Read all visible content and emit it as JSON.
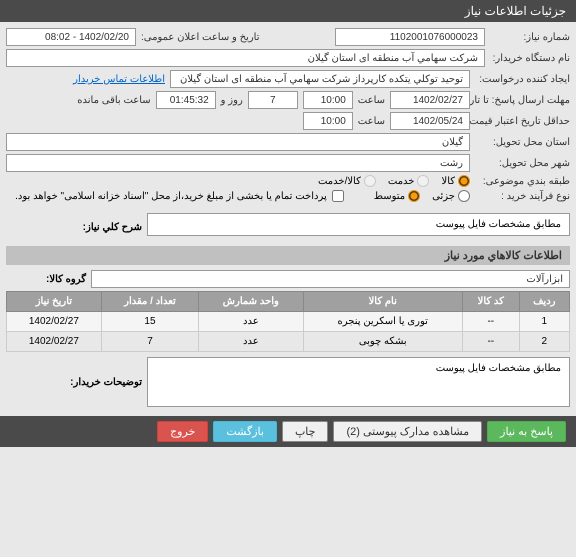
{
  "header": {
    "title": "جزئیات اطلاعات نیاز"
  },
  "fields": {
    "need_number_label": "شماره نیاز:",
    "need_number": "1102001076000023",
    "public_announce_label": "تاریخ و ساعت اعلان عمومی:",
    "public_announce": "1402/02/20 - 08:02",
    "buyer_label": "نام دستگاه خریدار:",
    "buyer": "شرکت سهامي آب منطقه ای استان گيلان",
    "request_creator_label": "ایجاد کننده درخواست:",
    "request_creator": "توحید توکلي یتکده کارپرداز شرکت سهامي آب منطقه ای استان گيلان",
    "contact_link": "اطلاعات تماس خریدار",
    "deadline_send_label": "مهلت ارسال پاسخ: تا تاریخ:",
    "deadline_date": "1402/02/27",
    "time_label1": "ساعت",
    "deadline_time": "10:00",
    "days_label": "روز و",
    "days": "7",
    "remaining_label": "ساعت باقی مانده",
    "remaining": "01:45:32",
    "validity_label": "حداقل تاریخ اعتبار قیمت: تا تاریخ:",
    "validity_date": "1402/05/24",
    "time_label2": "ساعت",
    "validity_time": "10:00",
    "province_label": "استان محل تحویل:",
    "province": "گیلان",
    "city_label": "شهر محل تحویل:",
    "city": "رشت",
    "category_label": "طبقه بندي موضوعی:",
    "cat_goods": "کالا",
    "cat_service": "خدمت",
    "cat_goods_service": "کالا/خدمت",
    "process_label": "نوع فرآیند خرید :",
    "process_partial": "جزئی",
    "process_medium": "متوسط",
    "treasury_text": "پرداخت تمام یا بخشی از مبلغ خرید،از محل \"اسناد خزانه اسلامی\" خواهد بود.",
    "desc_label": "شرح کلي نیاز:",
    "desc": "مطابق مشخصات فایل پیوست",
    "items_section": "اطلاعات کالاهاي مورد نیاز",
    "group_label": "گروه کالا:",
    "group": "ابزارآلات",
    "buyer_notes_label": "توضیحات خریدار:",
    "buyer_notes": "مطابق مشخصات فایل پیوست"
  },
  "table": {
    "headers": {
      "row": "ردیف",
      "code": "کد کالا",
      "name": "نام کالا",
      "unit": "واحد شمارش",
      "qty": "تعداد / مقدار",
      "date": "تاریخ نیاز"
    },
    "rows": [
      {
        "row": "1",
        "code": "--",
        "name": "توری یا اسکرین پنجره",
        "unit": "عدد",
        "qty": "15",
        "date": "1402/02/27"
      },
      {
        "row": "2",
        "code": "--",
        "name": "بشکه چوبی",
        "unit": "عدد",
        "qty": "7",
        "date": "1402/02/27"
      }
    ]
  },
  "buttons": {
    "respond": "پاسخ به نیاز",
    "attachments": "مشاهده مدارک پیوستی (2)",
    "print": "چاپ",
    "back": "بازگشت",
    "exit": "خروج"
  }
}
